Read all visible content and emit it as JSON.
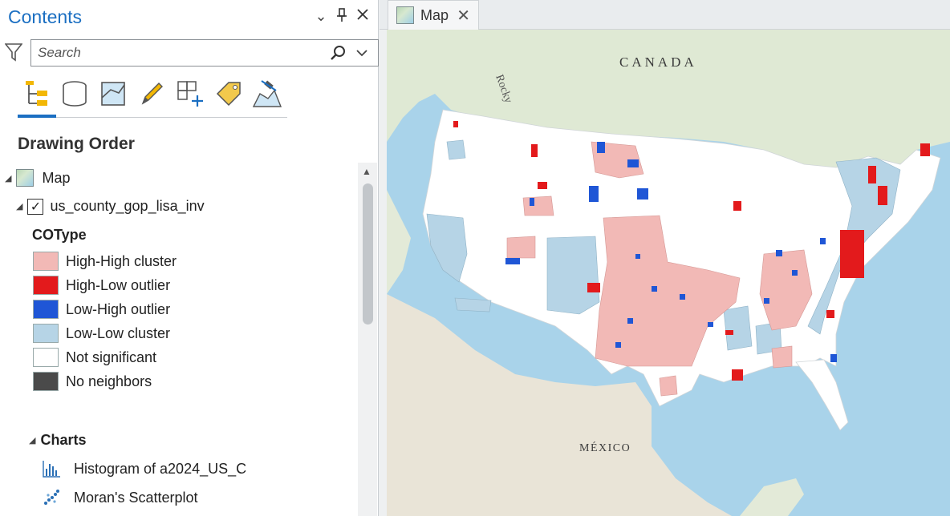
{
  "contents": {
    "title": "Contents",
    "search_placeholder": "Search",
    "section_title": "Drawing Order",
    "map_name": "Map",
    "layer_name": "us_county_gop_lisa_inv",
    "field_name": "COType",
    "legend": [
      {
        "label": "High-High cluster",
        "color": "#f2b9b6"
      },
      {
        "label": "High-Low outlier",
        "color": "#e31a1c"
      },
      {
        "label": "Low-High outlier",
        "color": "#1f56d6"
      },
      {
        "label": "Low-Low cluster",
        "color": "#b6d4e6"
      },
      {
        "label": "Not significant",
        "color": "#ffffff"
      },
      {
        "label": "No neighbors",
        "color": "#4a4a4a"
      }
    ],
    "charts_label": "Charts",
    "charts": [
      {
        "label": "Histogram of a2024_US_C",
        "icon": "histogram-icon"
      },
      {
        "label": "Moran's Scatterplot",
        "icon": "scatterplot-icon"
      }
    ]
  },
  "map_tab": {
    "label": "Map"
  },
  "map_labels": {
    "canada": "CANADA",
    "mexico": "MÉXICO",
    "rocky": "Rocky"
  },
  "colors": {
    "accent": "#1b6fc2",
    "water": "#a9d3ea",
    "land": "#f4f1ea"
  }
}
